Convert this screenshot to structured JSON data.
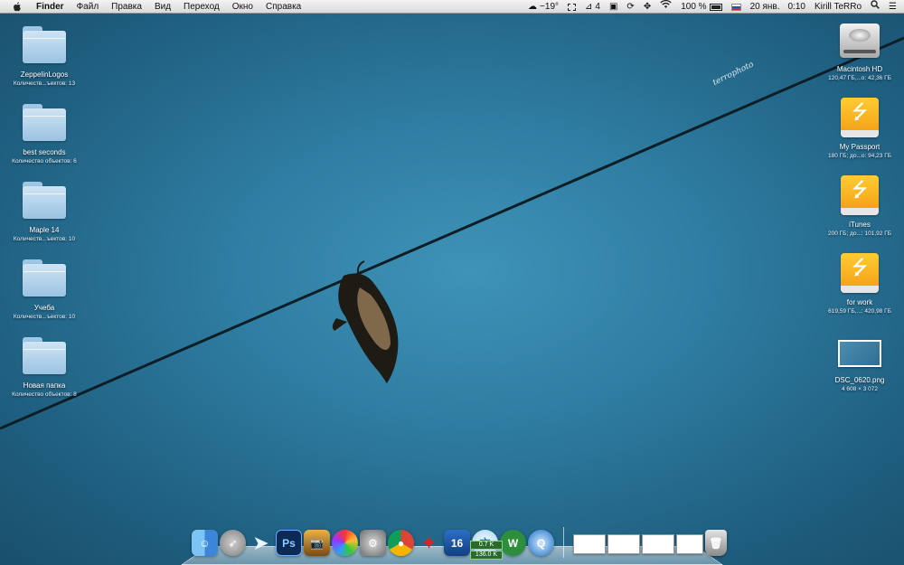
{
  "menubar": {
    "app_name": "Finder",
    "menus": [
      "Файл",
      "Правка",
      "Вид",
      "Переход",
      "Окно",
      "Справка"
    ],
    "status": {
      "weather": "−19°",
      "spaces": "4",
      "battery": "100 %",
      "date": "20 янв.",
      "time": "0:10",
      "user": "Kirill TeRRo"
    }
  },
  "wallpaper": {
    "watermark": "terrophoto"
  },
  "desktop_left": [
    {
      "name": "ZeppelinLogos",
      "meta": "Количеств...ъектов: 13"
    },
    {
      "name": "best seconds",
      "meta": "Количество объектов: 6"
    },
    {
      "name": "Maple 14",
      "meta": "Количеств...ъектов: 10"
    },
    {
      "name": "Учеба",
      "meta": "Количеств...ъектов: 10"
    },
    {
      "name": "Новая папка",
      "meta": "Количество объектов: 8"
    }
  ],
  "desktop_right": [
    {
      "name": "Macintosh HD",
      "meta": "120,47 ГБ,...о: 42,36 ГБ",
      "icon": "hard-drive"
    },
    {
      "name": "My Passport",
      "meta": "180 ГБ; до...о: 94,23 ГБ",
      "icon": "usb-drive"
    },
    {
      "name": "iTunes",
      "meta": "200 ГБ; до...: 101,92 ГБ",
      "icon": "usb-drive"
    },
    {
      "name": "for work",
      "meta": "619,59 ГБ,...: 420,98 ГБ",
      "icon": "usb-drive"
    },
    {
      "name": "DSC_0620.png",
      "meta": "4 608 × 3 072",
      "icon": "image-file"
    }
  ],
  "dock": {
    "badge_number": "16",
    "net_up": "0.7 K",
    "net_down": "136.0 K"
  },
  "colors": {
    "wallpaper": "#2f7ea3",
    "usb_drive": "#f6a81a",
    "folder": "#b4d4ec"
  }
}
